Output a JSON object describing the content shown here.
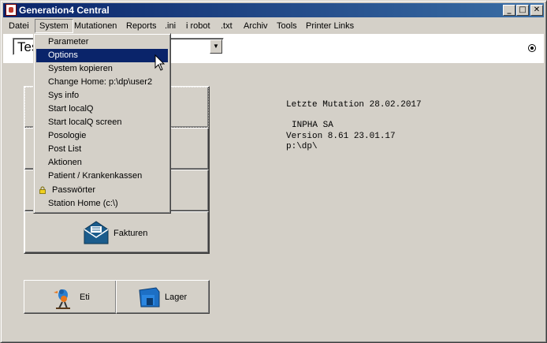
{
  "window": {
    "title": "Generation4 Central",
    "controls": {
      "minimize": "_",
      "maximize": "□",
      "close": "✕"
    }
  },
  "menubar": {
    "items": [
      {
        "label": "Datei"
      },
      {
        "label": "System"
      },
      {
        "label": "Mutationen"
      },
      {
        "label": "Reports"
      },
      {
        "label": ".ini"
      },
      {
        "label": "i robot"
      },
      {
        "label": ".txt"
      },
      {
        "label": "Archiv"
      },
      {
        "label": "Tools"
      },
      {
        "label": "Printer Links"
      }
    ]
  },
  "toolbar": {
    "combo_value": "Tes",
    "combo_arrow": "▼"
  },
  "system_menu": {
    "items": [
      {
        "label": "Parameter"
      },
      {
        "label": "Options",
        "selected": true
      },
      {
        "label": "System kopieren"
      },
      {
        "label": "Change Home: p:\\dp\\user2"
      },
      {
        "label": "Sys info"
      },
      {
        "label": "Start localQ"
      },
      {
        "label": "Start localQ screen"
      },
      {
        "label": "Posologie"
      },
      {
        "label": "Post List"
      },
      {
        "label": "Aktionen"
      },
      {
        "label": "Patient / Krankenkassen"
      },
      {
        "label": "Passwörter",
        "icon": "lock-icon"
      },
      {
        "label": "Station Home (c:\\)"
      }
    ]
  },
  "main": {
    "fakturen_label": "Fakturen",
    "eti_label": "Eti",
    "lager_label": "Lager",
    "info": {
      "last_mutation": "Letzte Mutation 28.02.2017",
      "company": "INPHA SA",
      "version": "Version 8.61 23.01.17",
      "path": "p:\\dp\\"
    }
  },
  "colors": {
    "title_active": "#0a246a",
    "menu_selection": "#0a246a",
    "window_face": "#d4d0c8"
  }
}
